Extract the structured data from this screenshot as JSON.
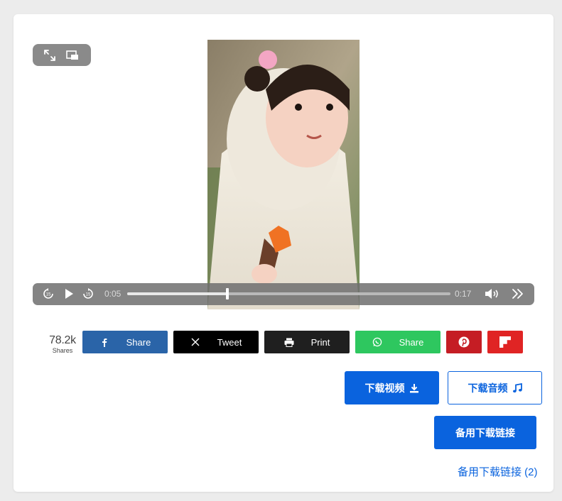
{
  "player": {
    "top_controls": {
      "fullscreen_icon": "expand-arrows-icon",
      "pip_icon": "picture-in-picture-icon"
    },
    "current_time": "0:05",
    "duration": "0:17",
    "progress_fraction": 0.31,
    "controls": {
      "rewind_icon": "rewind-15-icon",
      "play_icon": "play-icon",
      "forward_icon": "forward-15-icon",
      "volume_icon": "volume-icon",
      "speed_icon": "fast-forward-icon"
    }
  },
  "share": {
    "count": "78.2k",
    "count_label": "Shares",
    "buttons": [
      {
        "network": "facebook",
        "label": "Share",
        "icon": "facebook-icon",
        "color": "#2a64a8"
      },
      {
        "network": "x",
        "label": "Tweet",
        "icon": "x-icon",
        "color": "#000000"
      },
      {
        "network": "print",
        "label": "Print",
        "icon": "printer-icon",
        "color": "#1f1f1f"
      },
      {
        "network": "whatsapp",
        "label": "Share",
        "icon": "whatsapp-icon",
        "color": "#2ec75f"
      },
      {
        "network": "pinterest",
        "label": "",
        "icon": "pinterest-icon",
        "color": "#c51d24"
      },
      {
        "network": "flipboard",
        "label": "",
        "icon": "flipboard-icon",
        "color": "#e02424"
      }
    ]
  },
  "download": {
    "video_label": "下载视频",
    "audio_label": "下载音频",
    "alt_label": "备用下载链接",
    "alt_link_label": "备用下载链接 (2)",
    "accent": "#0a63de"
  }
}
